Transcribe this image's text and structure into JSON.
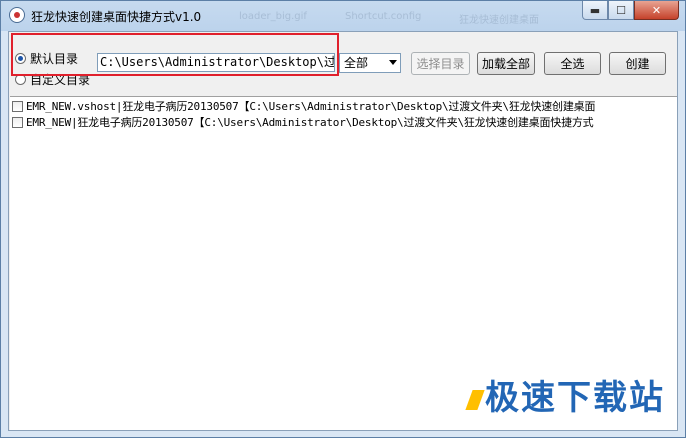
{
  "window": {
    "title": "狂龙快速创建桌面快捷方式v1.0",
    "background_items": [
      "loader_big.gif",
      "Shortcut.config",
      "狂龙快速创建桌面"
    ],
    "buttons": {
      "minimize": "▬",
      "maximize": "☐",
      "close": "✕"
    }
  },
  "toolbar": {
    "radio_default_label": "默认目录",
    "radio_custom_label": "自定义目录",
    "radio_selected": "default",
    "path_value": "C:\\Users\\Administrator\\Desktop\\过渡",
    "filter_selected": "全部",
    "choose_dir_label": "选择目录",
    "load_all_label": "加载全部",
    "select_all_label": "全选",
    "create_label": "创建"
  },
  "list": {
    "items": [
      {
        "checked": false,
        "text": "EMR_NEW.vshost|狂龙电子病历20130507【C:\\Users\\Administrator\\Desktop\\过渡文件夹\\狂龙快速创建桌面"
      },
      {
        "checked": false,
        "text": "EMR_NEW|狂龙电子病历20130507【C:\\Users\\Administrator\\Desktop\\过渡文件夹\\狂龙快速创建桌面快捷方式"
      }
    ]
  },
  "watermark": {
    "text": "极速下载站"
  },
  "colors": {
    "highlight": "#e0202c",
    "accent": "#2266b5",
    "selected_dot": "#1d54a8"
  }
}
